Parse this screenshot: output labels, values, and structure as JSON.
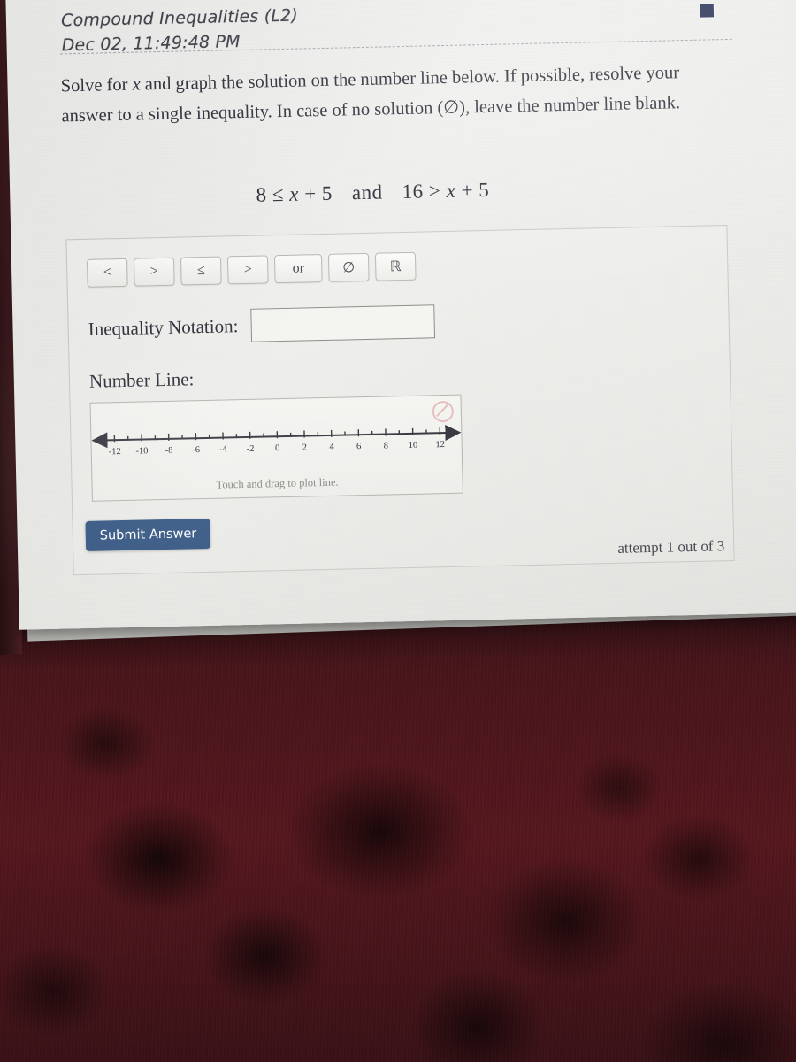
{
  "header": {
    "title": "Compound Inequalities (L2)",
    "timestamp": "Dec 02, 11:49:48 PM",
    "help_icon": "question-mark-icon"
  },
  "prompt": {
    "line1_a": "Solve for ",
    "line1_x": "x",
    "line1_b": " and graph the solution on the number line below. If possible, resolve your answer to a single inequality. In case of no solution (∅), leave the number line blank."
  },
  "equation": {
    "left": "8 ≤ x + 5",
    "conjunction": "and",
    "right": "16 > x + 5",
    "full": "8 ≤ x + 5 and 16 > x + 5"
  },
  "toolbar": {
    "buttons": [
      {
        "label": "<",
        "name": "less-than-button"
      },
      {
        "label": ">",
        "name": "greater-than-button"
      },
      {
        "label": "≤",
        "name": "less-than-or-equal-button"
      },
      {
        "label": "≥",
        "name": "greater-than-or-equal-button"
      },
      {
        "label": "or",
        "name": "or-button"
      },
      {
        "label": "∅",
        "name": "empty-set-button"
      },
      {
        "label": "ℝ",
        "name": "real-numbers-button"
      }
    ]
  },
  "fields": {
    "notation_label": "Inequality Notation:",
    "notation_value": "",
    "notation_placeholder": "",
    "numberline_label": "Number Line:"
  },
  "numberline": {
    "hint": "Touch and drag to plot line.",
    "clear_icon": "no-entry-icon",
    "min": -12,
    "max": 12,
    "tick_step": 1,
    "label_step": 2,
    "labels": [
      "-12",
      "-10",
      "-8",
      "-6",
      "-4",
      "-2",
      "0",
      "2",
      "4",
      "6",
      "8",
      "10",
      "12"
    ],
    "plotted": false
  },
  "actions": {
    "submit_label": "Submit Answer",
    "attempt_text": "attempt 1 out of 3"
  },
  "colors": {
    "submit_bg": "#3a5b86",
    "help_icon": "#3c4466",
    "clear_icon": "#e3b3b3",
    "page_bg": "#eeeeec",
    "fabric": "#55181e"
  }
}
